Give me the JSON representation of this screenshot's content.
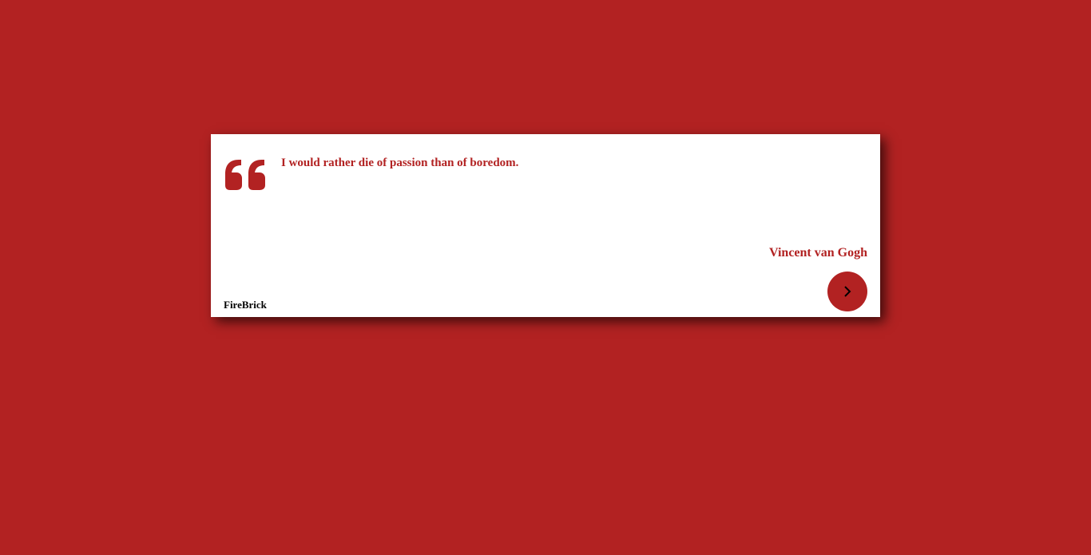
{
  "colors": {
    "background": "#B22222",
    "card": "#FFFFFF",
    "accent": "#B22222",
    "label": "#000000"
  },
  "quote": {
    "text": "I would rather die of passion than of boredom.",
    "author": "Vincent van Gogh",
    "icon": "quote-icon"
  },
  "footer": {
    "color_name": "FireBrick",
    "next_icon": "chevron-right-icon"
  }
}
